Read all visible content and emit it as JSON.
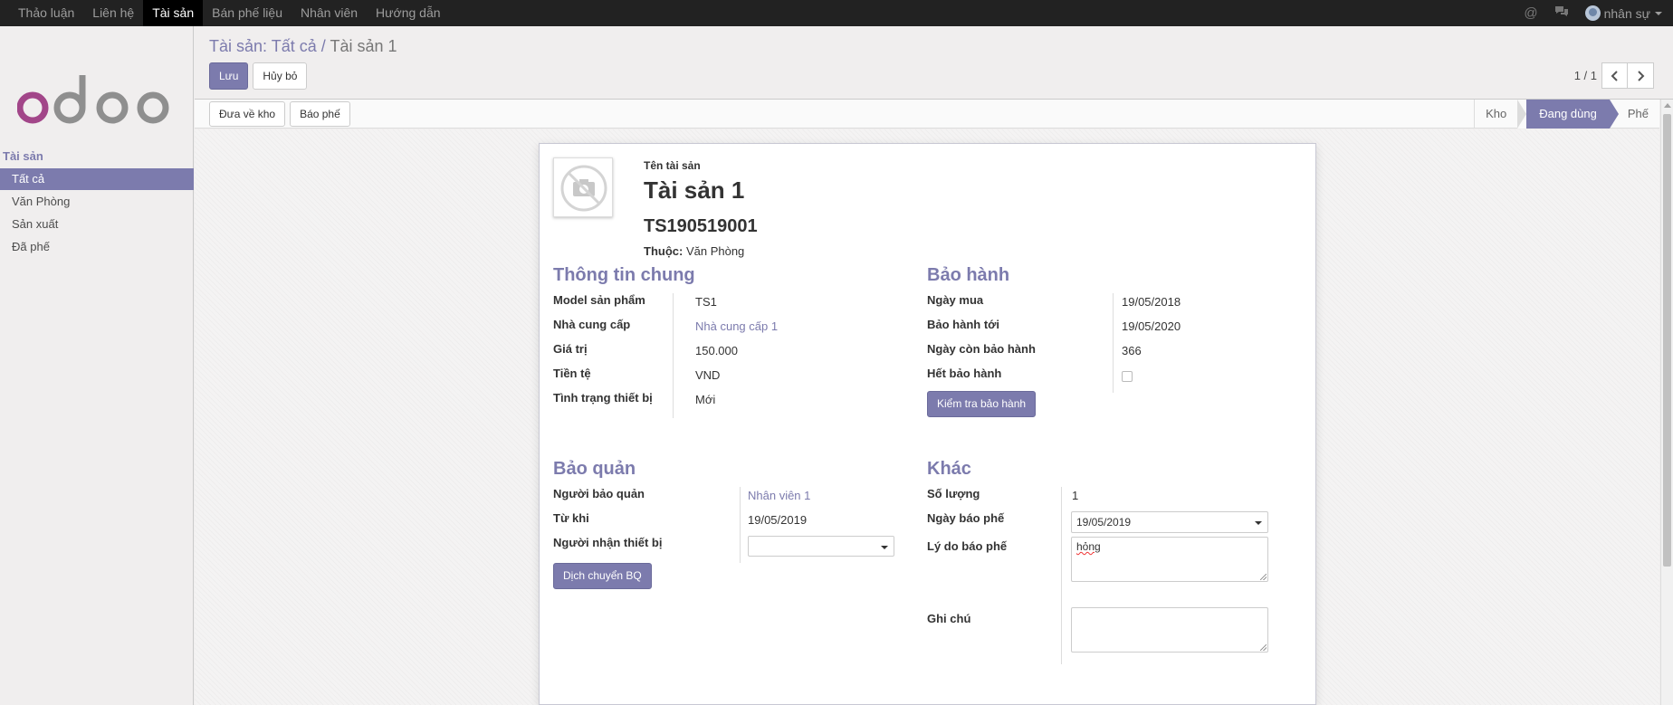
{
  "topbar": {
    "menu": [
      "Thảo luận",
      "Liên hệ",
      "Tài sản",
      "Bán phế liệu",
      "Nhân viên",
      "Hướng dẫn"
    ],
    "active_index": 2,
    "user": "nhân sự"
  },
  "sidebar": {
    "section": "Tài sản",
    "items": [
      "Tất cả",
      "Văn Phòng",
      "Sản xuất",
      "Đã phế"
    ],
    "active_index": 0
  },
  "breadcrumb": {
    "parent": "Tài sản: Tất cả",
    "separator": "/",
    "current": "Tài sản 1"
  },
  "buttons": {
    "save": "Lưu",
    "discard": "Hủy bỏ",
    "to_stock": "Đưa về kho",
    "report_scrap": "Báo phế",
    "check_warranty": "Kiểm tra bảo hành",
    "move_keeper": "Dịch chuyển BQ"
  },
  "pager": {
    "value": "1 / 1"
  },
  "stages": [
    "Kho",
    "Đang dùng",
    "Phế"
  ],
  "stage_active_index": 1,
  "record": {
    "name_label": "Tên tài sản",
    "name": "Tài sản 1",
    "code": "TS190519001",
    "belong_label": "Thuộc:",
    "belong": "Văn Phòng"
  },
  "general": {
    "title": "Thông tin chung",
    "fields": [
      {
        "label": "Model sản phẩm",
        "value": "TS1"
      },
      {
        "label": "Nhà cung cấp",
        "value": "Nhà cung cấp 1"
      },
      {
        "label": "Giá trị",
        "value": "150.000"
      },
      {
        "label": "Tiền tệ",
        "value": "VND"
      },
      {
        "label": "Tình trạng thiết bị",
        "value": "Mới"
      }
    ]
  },
  "warranty": {
    "title": "Bảo hành",
    "fields": [
      {
        "label": "Ngày mua",
        "value": "19/05/2018"
      },
      {
        "label": "Bảo hành tới",
        "value": "19/05/2020"
      },
      {
        "label": "Ngày còn bảo hành",
        "value": "366"
      },
      {
        "label": "Hết bảo hành",
        "value": ""
      }
    ],
    "expired_checked": false
  },
  "storage": {
    "title": "Bảo quản",
    "fields": [
      {
        "label": "Người bảo quản",
        "value": "Nhân viên 1"
      },
      {
        "label": "Từ khi",
        "value": "19/05/2019"
      },
      {
        "label": "Người nhận thiết bị",
        "value": ""
      }
    ]
  },
  "other": {
    "title": "Khác",
    "fields": [
      {
        "label": "Số lượng",
        "value": "1"
      },
      {
        "label": "Ngày báo phế",
        "value": "19/05/2019"
      },
      {
        "label": "Lý do báo phế",
        "value": "hỏng"
      },
      {
        "label": "Ghi chú",
        "value": ""
      }
    ]
  },
  "colors": {
    "accent": "#7c7bad",
    "topbar": "#222222",
    "logo_o": "#a24689",
    "logo_gray": "#8f8f8f"
  }
}
